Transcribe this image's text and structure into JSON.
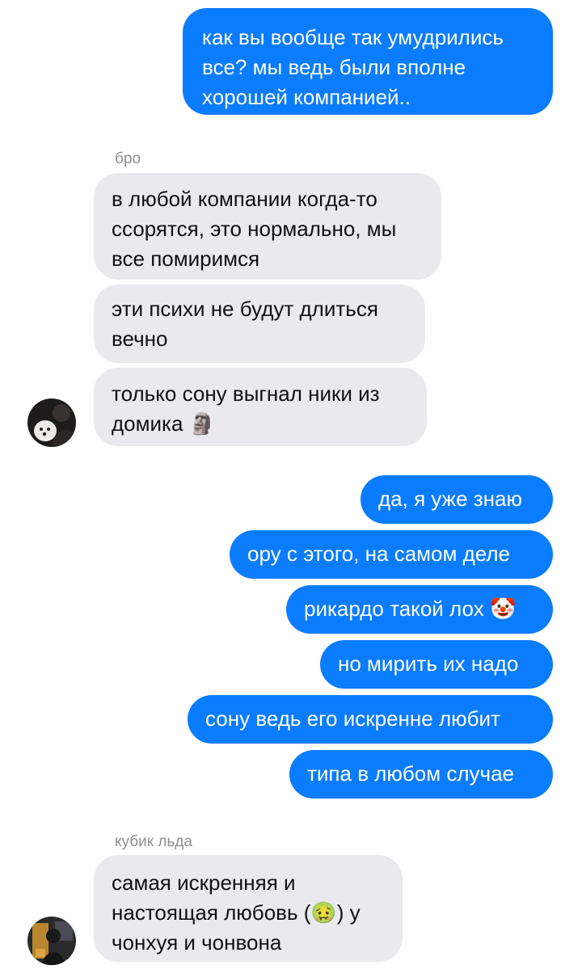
{
  "colors": {
    "outgoing_bubble": "#0a7cff",
    "incoming_bubble": "#e9e9ee",
    "sender_name": "#8e8e93"
  },
  "thread": {
    "msg1": {
      "line1": "как вы вообще так умудрились",
      "line2": "все? мы ведь были вполне",
      "line3": "хорошей компанией.."
    },
    "group1": {
      "sender": "бро",
      "avatar_icon": "user-avatar-icon",
      "msg1": {
        "line1": "в любой компании когда-то",
        "line2": "ссорятся, это нормально, мы",
        "line3": "все помиримся"
      },
      "msg2": {
        "line1": "эти психи не будут длиться",
        "line2": "вечно"
      },
      "msg3": {
        "line1": "только сону выгнал ники из",
        "line2": "домика",
        "emoji": "🗿"
      }
    },
    "out_group": {
      "msg1": "да, я уже знаю",
      "msg2": "ору с этого, на самом деле",
      "msg3": {
        "text": "рикардо такой лох",
        "emoji": "🤡"
      },
      "msg4": "но мирить их надо",
      "msg5": "сону ведь его искренне любит",
      "msg6": "типа в любом случае"
    },
    "group2": {
      "sender": "кубик льда",
      "avatar_icon": "user-avatar-icon",
      "msg1": {
        "line1": "самая искренняя и",
        "line2a": "настоящая любовь (",
        "emoji": "🤢",
        "line2b": ") у",
        "line3": "чонхуя и чонвона"
      }
    }
  }
}
